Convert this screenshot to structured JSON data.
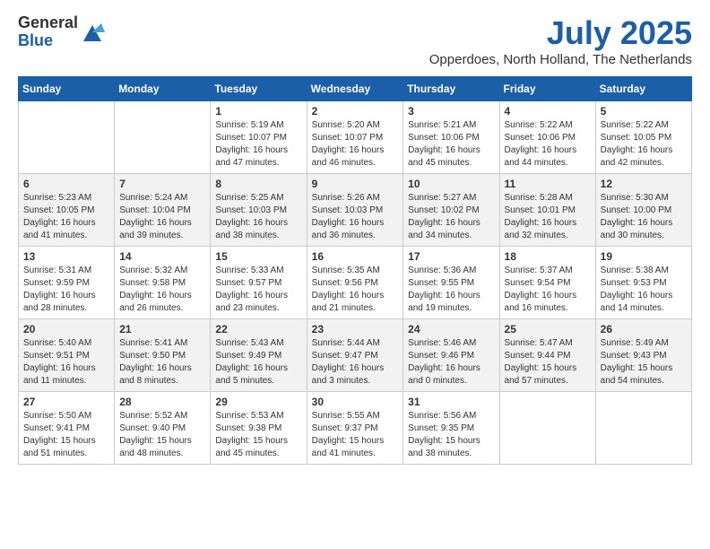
{
  "logo": {
    "general": "General",
    "blue": "Blue"
  },
  "header": {
    "title": "July 2025",
    "subtitle": "Opperdoes, North Holland, The Netherlands"
  },
  "weekdays": [
    "Sunday",
    "Monday",
    "Tuesday",
    "Wednesday",
    "Thursday",
    "Friday",
    "Saturday"
  ],
  "weeks": [
    [
      {
        "day": "",
        "info": ""
      },
      {
        "day": "",
        "info": ""
      },
      {
        "day": "1",
        "info": "Sunrise: 5:19 AM\nSunset: 10:07 PM\nDaylight: 16 hours and 47 minutes."
      },
      {
        "day": "2",
        "info": "Sunrise: 5:20 AM\nSunset: 10:07 PM\nDaylight: 16 hours and 46 minutes."
      },
      {
        "day": "3",
        "info": "Sunrise: 5:21 AM\nSunset: 10:06 PM\nDaylight: 16 hours and 45 minutes."
      },
      {
        "day": "4",
        "info": "Sunrise: 5:22 AM\nSunset: 10:06 PM\nDaylight: 16 hours and 44 minutes."
      },
      {
        "day": "5",
        "info": "Sunrise: 5:22 AM\nSunset: 10:05 PM\nDaylight: 16 hours and 42 minutes."
      }
    ],
    [
      {
        "day": "6",
        "info": "Sunrise: 5:23 AM\nSunset: 10:05 PM\nDaylight: 16 hours and 41 minutes."
      },
      {
        "day": "7",
        "info": "Sunrise: 5:24 AM\nSunset: 10:04 PM\nDaylight: 16 hours and 39 minutes."
      },
      {
        "day": "8",
        "info": "Sunrise: 5:25 AM\nSunset: 10:03 PM\nDaylight: 16 hours and 38 minutes."
      },
      {
        "day": "9",
        "info": "Sunrise: 5:26 AM\nSunset: 10:03 PM\nDaylight: 16 hours and 36 minutes."
      },
      {
        "day": "10",
        "info": "Sunrise: 5:27 AM\nSunset: 10:02 PM\nDaylight: 16 hours and 34 minutes."
      },
      {
        "day": "11",
        "info": "Sunrise: 5:28 AM\nSunset: 10:01 PM\nDaylight: 16 hours and 32 minutes."
      },
      {
        "day": "12",
        "info": "Sunrise: 5:30 AM\nSunset: 10:00 PM\nDaylight: 16 hours and 30 minutes."
      }
    ],
    [
      {
        "day": "13",
        "info": "Sunrise: 5:31 AM\nSunset: 9:59 PM\nDaylight: 16 hours and 28 minutes."
      },
      {
        "day": "14",
        "info": "Sunrise: 5:32 AM\nSunset: 9:58 PM\nDaylight: 16 hours and 26 minutes."
      },
      {
        "day": "15",
        "info": "Sunrise: 5:33 AM\nSunset: 9:57 PM\nDaylight: 16 hours and 23 minutes."
      },
      {
        "day": "16",
        "info": "Sunrise: 5:35 AM\nSunset: 9:56 PM\nDaylight: 16 hours and 21 minutes."
      },
      {
        "day": "17",
        "info": "Sunrise: 5:36 AM\nSunset: 9:55 PM\nDaylight: 16 hours and 19 minutes."
      },
      {
        "day": "18",
        "info": "Sunrise: 5:37 AM\nSunset: 9:54 PM\nDaylight: 16 hours and 16 minutes."
      },
      {
        "day": "19",
        "info": "Sunrise: 5:38 AM\nSunset: 9:53 PM\nDaylight: 16 hours and 14 minutes."
      }
    ],
    [
      {
        "day": "20",
        "info": "Sunrise: 5:40 AM\nSunset: 9:51 PM\nDaylight: 16 hours and 11 minutes."
      },
      {
        "day": "21",
        "info": "Sunrise: 5:41 AM\nSunset: 9:50 PM\nDaylight: 16 hours and 8 minutes."
      },
      {
        "day": "22",
        "info": "Sunrise: 5:43 AM\nSunset: 9:49 PM\nDaylight: 16 hours and 5 minutes."
      },
      {
        "day": "23",
        "info": "Sunrise: 5:44 AM\nSunset: 9:47 PM\nDaylight: 16 hours and 3 minutes."
      },
      {
        "day": "24",
        "info": "Sunrise: 5:46 AM\nSunset: 9:46 PM\nDaylight: 16 hours and 0 minutes."
      },
      {
        "day": "25",
        "info": "Sunrise: 5:47 AM\nSunset: 9:44 PM\nDaylight: 15 hours and 57 minutes."
      },
      {
        "day": "26",
        "info": "Sunrise: 5:49 AM\nSunset: 9:43 PM\nDaylight: 15 hours and 54 minutes."
      }
    ],
    [
      {
        "day": "27",
        "info": "Sunrise: 5:50 AM\nSunset: 9:41 PM\nDaylight: 15 hours and 51 minutes."
      },
      {
        "day": "28",
        "info": "Sunrise: 5:52 AM\nSunset: 9:40 PM\nDaylight: 15 hours and 48 minutes."
      },
      {
        "day": "29",
        "info": "Sunrise: 5:53 AM\nSunset: 9:38 PM\nDaylight: 15 hours and 45 minutes."
      },
      {
        "day": "30",
        "info": "Sunrise: 5:55 AM\nSunset: 9:37 PM\nDaylight: 15 hours and 41 minutes."
      },
      {
        "day": "31",
        "info": "Sunrise: 5:56 AM\nSunset: 9:35 PM\nDaylight: 15 hours and 38 minutes."
      },
      {
        "day": "",
        "info": ""
      },
      {
        "day": "",
        "info": ""
      }
    ]
  ]
}
